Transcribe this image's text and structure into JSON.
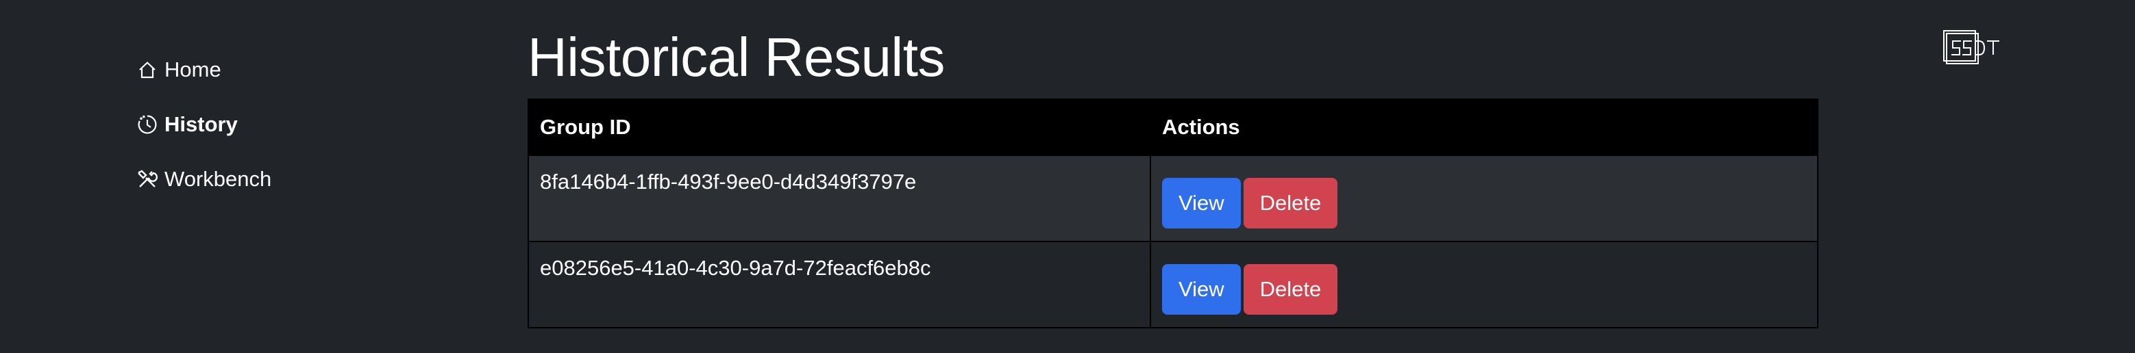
{
  "sidebar": {
    "items": [
      {
        "label": "Home",
        "icon": "home-icon",
        "active": false
      },
      {
        "label": "History",
        "icon": "clock-icon",
        "active": true
      },
      {
        "label": "Workbench",
        "icon": "tools-icon",
        "active": false
      }
    ]
  },
  "main": {
    "title": "Historical Results",
    "table": {
      "columns": [
        "Group ID",
        "Actions"
      ],
      "rows": [
        {
          "group_id": "8fa146b4-1ffb-493f-9ee0-d4d349f3797e",
          "view_label": "View",
          "delete_label": "Delete"
        },
        {
          "group_id": "e08256e5-41a0-4c30-9a7d-72feacf6eb8c",
          "view_label": "View",
          "delete_label": "Delete"
        }
      ]
    }
  },
  "logo": {
    "text": "SSDT"
  },
  "colors": {
    "background": "#212529",
    "table_header": "#000000",
    "row_striped": "#2c3034",
    "view_button": "#2f6fec",
    "delete_button": "#d0434f"
  }
}
